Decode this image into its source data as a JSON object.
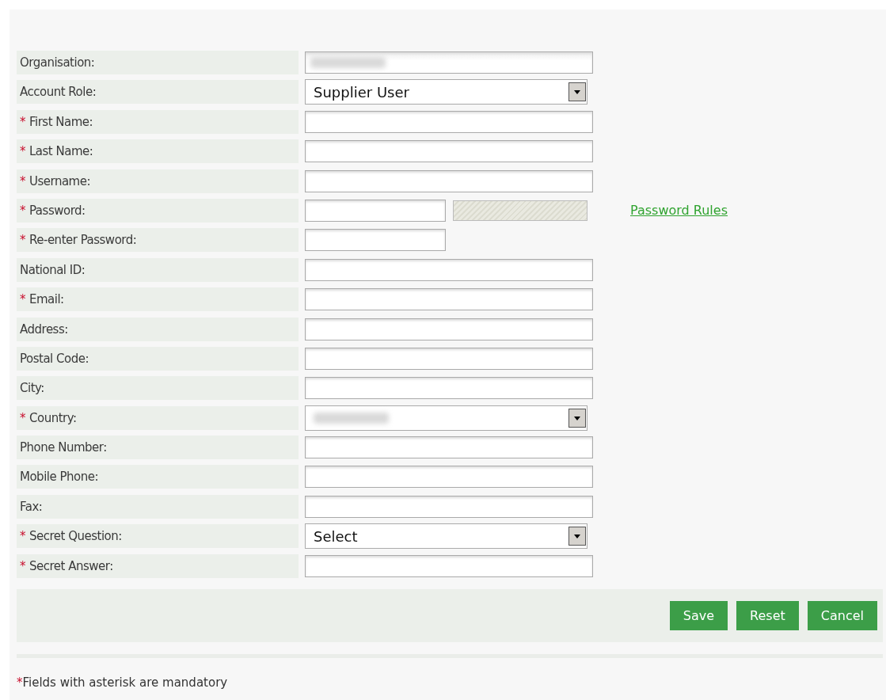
{
  "form": {
    "fields": [
      {
        "label": "Organisation:",
        "kind": "readonly"
      },
      {
        "label": "Account Role:",
        "kind": "select",
        "value": "Supplier User"
      },
      {
        "label": "First Name:",
        "kind": "text",
        "mark": "*"
      },
      {
        "label": "Last Name:",
        "kind": "text",
        "mark": "*"
      },
      {
        "label": "Username:",
        "kind": "text",
        "mark": "*"
      },
      {
        "label": "Password:",
        "kind": "password",
        "mark": "*",
        "strength": {
          "level": 0
        },
        "link": "Password Rules"
      },
      {
        "label": "Re-enter Password:",
        "kind": "short",
        "mark": "*"
      },
      {
        "label": "National ID:",
        "kind": "text"
      },
      {
        "label": "Email:",
        "kind": "text",
        "mark": "*"
      },
      {
        "label": "Address:",
        "kind": "text"
      },
      {
        "label": "Postal Code:",
        "kind": "text"
      },
      {
        "label": "City:",
        "kind": "text"
      },
      {
        "label": "Country:",
        "kind": "select-redacted",
        "mark": "*"
      },
      {
        "label": "Phone Number:",
        "kind": "text"
      },
      {
        "label": "Mobile Phone:",
        "kind": "text"
      },
      {
        "label": "Fax:",
        "kind": "text"
      },
      {
        "label": "Secret Question:",
        "kind": "select",
        "value": "Select",
        "mark": "*"
      },
      {
        "label": "Secret Answer:",
        "kind": "text",
        "mark": "*"
      }
    ],
    "buttons": [
      "Save",
      "Reset",
      "Cancel"
    ]
  },
  "note": {
    "mark": "*",
    "text": "Fields with asterisk are mandatory"
  }
}
